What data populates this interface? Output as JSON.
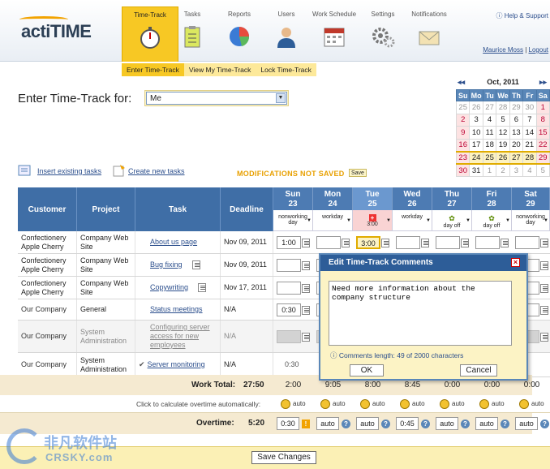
{
  "app": {
    "logo": "actiTIME"
  },
  "nav": [
    {
      "label": "Time-Track",
      "icon": "stopwatch-icon",
      "active": true
    },
    {
      "label": "Tasks",
      "icon": "clipboard-icon",
      "active": false
    },
    {
      "label": "Reports",
      "icon": "pie-chart-icon",
      "active": false
    },
    {
      "label": "Users",
      "icon": "user-icon",
      "active": false
    },
    {
      "label": "Work Schedule",
      "icon": "calendar-icon",
      "active": false
    },
    {
      "label": "Settings",
      "icon": "gears-icon",
      "active": false
    },
    {
      "label": "Notifications",
      "icon": "envelope-icon",
      "active": false
    }
  ],
  "top_right": {
    "help": "Help & Support",
    "user": "Maurice Moss",
    "logout": "Logout"
  },
  "subnav": [
    "Enter Time-Track",
    "View My Time-Track",
    "Lock Time-Track"
  ],
  "page": {
    "title": "Enter Time-Track for:",
    "user_select": "Me"
  },
  "calendar": {
    "month": "Oct, 2011",
    "prev": "◂◂",
    "next": "▸▸",
    "days": [
      "Su",
      "Mo",
      "Tu",
      "We",
      "Th",
      "Fr",
      "Sa"
    ],
    "weeks": [
      [
        "25",
        "26",
        "27",
        "28",
        "29",
        "30",
        "1"
      ],
      [
        "2",
        "3",
        "4",
        "5",
        "6",
        "7",
        "8"
      ],
      [
        "9",
        "10",
        "11",
        "12",
        "13",
        "14",
        "15"
      ],
      [
        "16",
        "17",
        "18",
        "19",
        "20",
        "21",
        "22"
      ],
      [
        "23",
        "24",
        "25",
        "26",
        "27",
        "28",
        "29"
      ],
      [
        "30",
        "31",
        "1",
        "2",
        "3",
        "4",
        "5"
      ]
    ]
  },
  "links": {
    "insert": "Insert existing tasks",
    "create": "Create new tasks",
    "not_saved": "MODIFICATIONS NOT SAVED",
    "save_small": "Save"
  },
  "grid": {
    "headers": {
      "customer": "Customer",
      "project": "Project",
      "task": "Task",
      "deadline": "Deadline"
    },
    "days": [
      {
        "name": "Sun",
        "num": "23",
        "type": "nonworking day"
      },
      {
        "name": "Mon",
        "num": "24",
        "type": "workday"
      },
      {
        "name": "Tue",
        "num": "25",
        "type": "3:00"
      },
      {
        "name": "Wed",
        "num": "26",
        "type": "workday"
      },
      {
        "name": "Thu",
        "num": "27",
        "type": "day off"
      },
      {
        "name": "Fri",
        "num": "28",
        "type": "day off"
      },
      {
        "name": "Sat",
        "num": "29",
        "type": "nonworking day"
      }
    ],
    "rows": [
      {
        "customer": "Confectionery Apple Cherry",
        "project": "Company Web Site",
        "task": "About us page",
        "deadline": "Nov 09, 2011",
        "sun": "1:00",
        "tue": "3:00"
      },
      {
        "customer": "Confectionery Apple Cherry",
        "project": "Company Web Site",
        "task": "Bug fixing",
        "deadline": "Nov 09, 2011"
      },
      {
        "customer": "Confectionery Apple Cherry",
        "project": "Company Web Site",
        "task": "Copywriting",
        "deadline": "Nov 17, 2011"
      },
      {
        "customer": "Our Company",
        "project": "General",
        "task": "Status meetings",
        "deadline": "N/A",
        "sun": "0:30"
      },
      {
        "customer": "Our Company",
        "project": "System Administration",
        "task": "Configuring server access for new employees",
        "deadline": "N/A"
      },
      {
        "customer": "Our Company",
        "project": "System Administration",
        "task": "Server monitoring",
        "deadline": "N/A",
        "sun": "0:30"
      }
    ],
    "work_total_label": "Work Total:",
    "work_total": "27:50",
    "day_totals": [
      "2:00",
      "9:05",
      "8:00",
      "8:45",
      "0:00",
      "0:00",
      "0:00"
    ],
    "calc_label": "Click to calculate overtime automatically:",
    "auto": "auto",
    "overtime_label": "Overtime:",
    "overtime": "5:20",
    "overtime_days": [
      "0:30",
      "auto",
      "auto",
      "0:45",
      "auto",
      "auto",
      "auto"
    ]
  },
  "dialog": {
    "title": "Edit Time-Track Comments",
    "text": "Need more information about the company structure",
    "info": "Comments length: 49 of 2000 characters",
    "ok": "OK",
    "cancel": "Cancel"
  },
  "footer": {
    "save": "Save Changes"
  },
  "watermark": {
    "cn": "非凡软件站",
    "en": "CRSKY.com"
  }
}
